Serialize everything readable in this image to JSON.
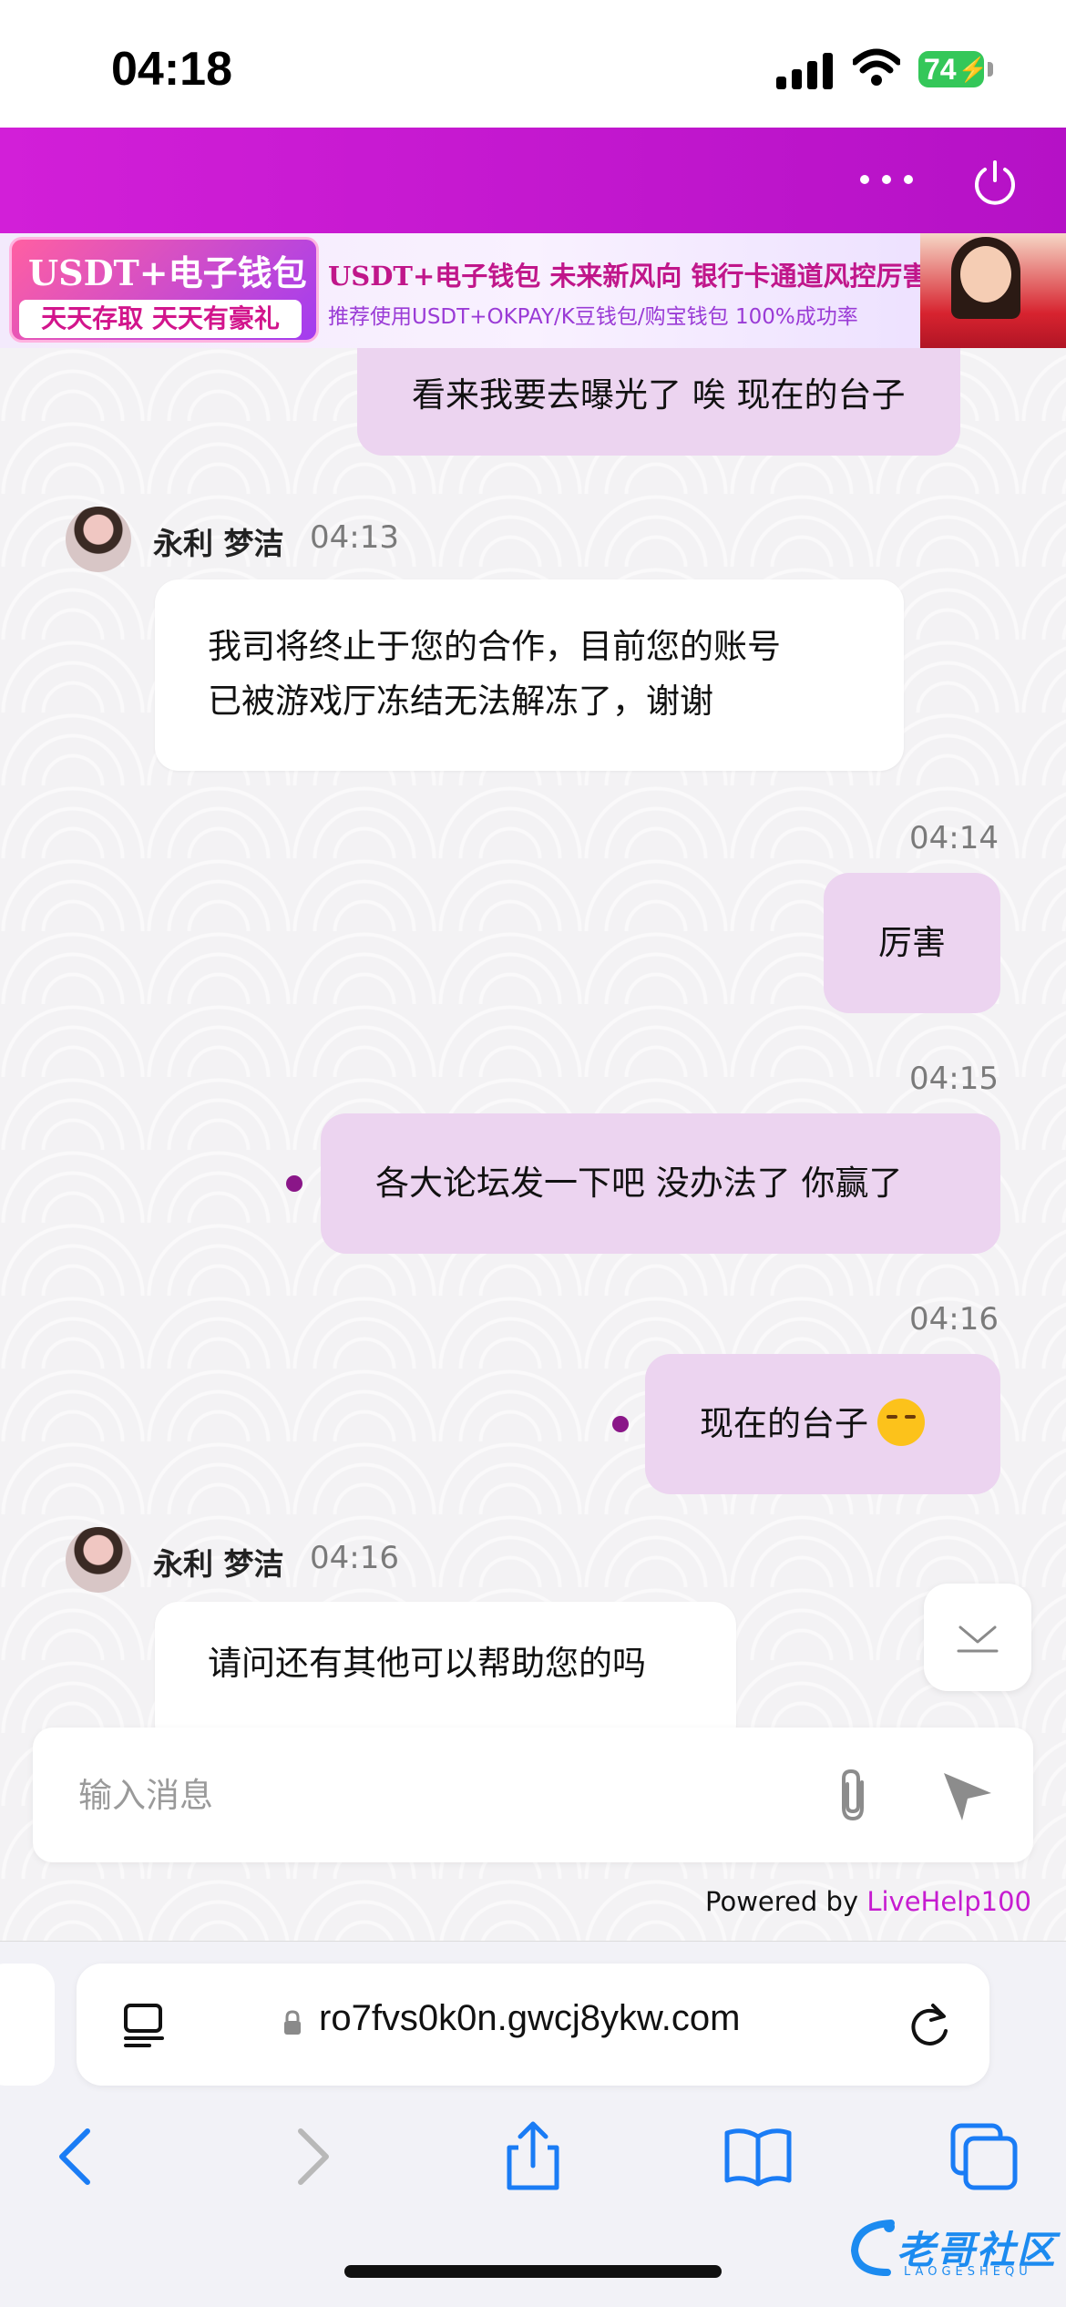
{
  "status_bar": {
    "time": "04:18",
    "battery": "74"
  },
  "banner": {
    "badge_title": "USDT+电子钱包",
    "badge_sub": "天天存取 天天有豪礼",
    "headline": "USDT+电子钱包  未来新风向  银行卡通道风控厉害",
    "sub": "推荐使用USDT+OKPAY/K豆钱包/购宝钱包  100%成功率"
  },
  "chat": {
    "messages": [
      {
        "direction": "out",
        "text": "看来我要去曝光了 唉 现在的台子"
      },
      {
        "direction": "in",
        "sender": "永利 梦洁",
        "time": "04:13",
        "lines": [
          "我司将终止于您的合作，目前您的账号",
          "已被游戏厅冻结无法解冻了，谢谢"
        ]
      },
      {
        "direction": "out",
        "time": "04:14",
        "text": "厉害"
      },
      {
        "direction": "out",
        "time": "04:15",
        "text": "各大论坛发一下吧 没办法了 你赢了"
      },
      {
        "direction": "out",
        "time": "04:16",
        "text": "现在的台子"
      },
      {
        "direction": "in",
        "sender": "永利 梦洁",
        "time": "04:16",
        "text": "请问还有其他可以帮助您的吗"
      }
    ]
  },
  "input": {
    "placeholder": "输入消息"
  },
  "footer": {
    "powered_prefix": "Powered by ",
    "powered_brand": "LiveHelp100"
  },
  "browser": {
    "url": "ro7fvs0k0n.gwcj8ykw.com"
  },
  "watermark": {
    "text": "老哥社区",
    "sub": "LAOGESHEQU"
  },
  "colors": {
    "header": "#c514cf",
    "outgoing_bubble": "#ecd4f0",
    "brand_link": "#c61bd0",
    "ios_blue": "#1a7cf5"
  }
}
